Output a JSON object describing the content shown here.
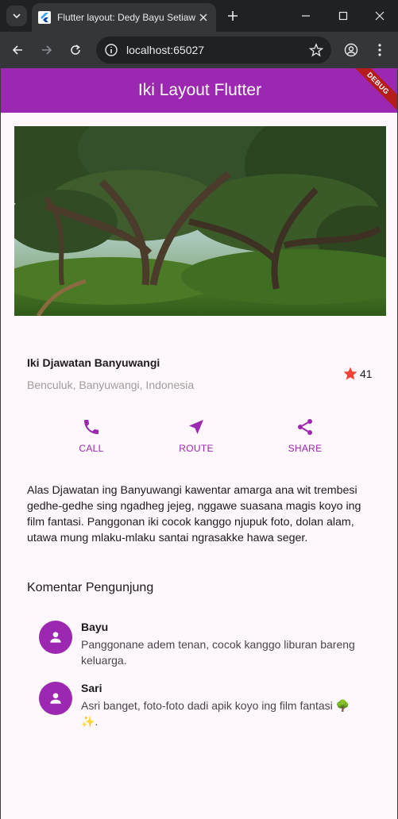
{
  "browser": {
    "tab_title": "Flutter layout: Dedy Bayu Setiawan",
    "url": "localhost:65027"
  },
  "app": {
    "title": "Iki Layout Flutter",
    "debug_banner": "DEBUG",
    "place": {
      "name": "Iki Djawatan Banyuwangi",
      "location": "Benculuk, Banyuwangi, Indonesia",
      "rating": "41"
    },
    "actions": [
      {
        "label": "CALL",
        "icon": "phone-icon"
      },
      {
        "label": "ROUTE",
        "icon": "navigation-icon"
      },
      {
        "label": "SHARE",
        "icon": "share-icon"
      }
    ],
    "description": "Alas Djawatan ing Banyuwangi kawentar amarga ana wit trembesi gedhe-gedhe sing ngadheg jejeg, nggawe suasana magis koyo ing film fantasi. Panggonan iki cocok kanggo njupuk foto, dolan alam, utawa mung mlaku-mlaku santai ngrasakke hawa seger.",
    "comments_title": "Komentar Pengunjung",
    "comments": [
      {
        "name": "Bayu",
        "text": "Panggonane adem tenan, cocok kanggo liburan bareng keluarga."
      },
      {
        "name": "Sari",
        "text": "Asri banget, foto-foto dadi apik koyo ing film fantasi 🌳✨."
      }
    ]
  },
  "colors": {
    "primary": "#9c27b0",
    "star": "#f44336",
    "background": "#fef7fb"
  }
}
